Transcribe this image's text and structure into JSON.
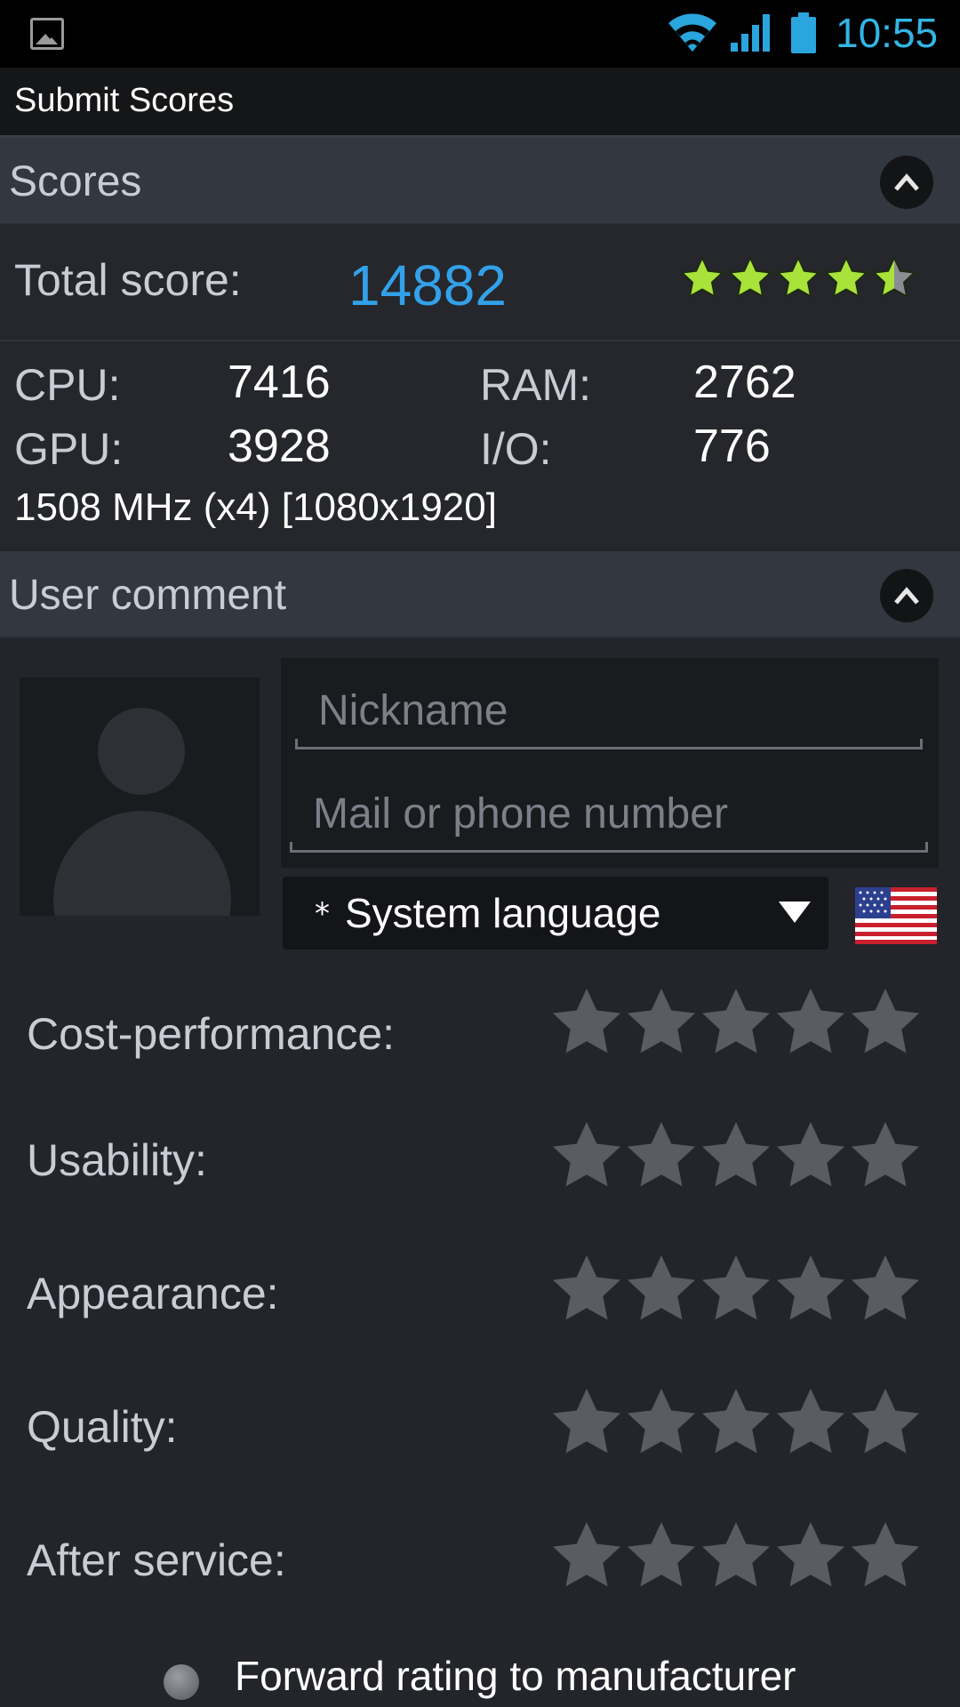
{
  "status_bar": {
    "time": "10:55",
    "accent": "#33b5e5"
  },
  "title_bar": {
    "title": "Submit Scores"
  },
  "scores_section": {
    "header": "Scores",
    "total_label": "Total score:",
    "total_value": "14882",
    "star_rating": 4.5,
    "cpu_label": "CPU:",
    "cpu_value": "7416",
    "ram_label": "RAM:",
    "ram_value": "2762",
    "gpu_label": "GPU:",
    "gpu_value": "3928",
    "io_label": "I/O:",
    "io_value": "776",
    "spec": "1508 MHz (x4) [1080x1920]"
  },
  "user_comment_section": {
    "header": "User comment",
    "nickname_placeholder": "Nickname",
    "contact_placeholder": "Mail or phone number",
    "language_marker": "*",
    "language_value": "System language",
    "ratings": [
      {
        "label": "Cost-performance:",
        "stars": 0
      },
      {
        "label": "Usability:",
        "stars": 0
      },
      {
        "label": "Appearance:",
        "stars": 0
      },
      {
        "label": "Quality:",
        "stars": 0
      },
      {
        "label": "After service:",
        "stars": 0
      }
    ],
    "forward_label": "Forward rating to manufacturer"
  },
  "colors": {
    "star_filled": "#a8e23a",
    "star_empty": "#5a5c62",
    "score_blue": "#33a1ea"
  }
}
